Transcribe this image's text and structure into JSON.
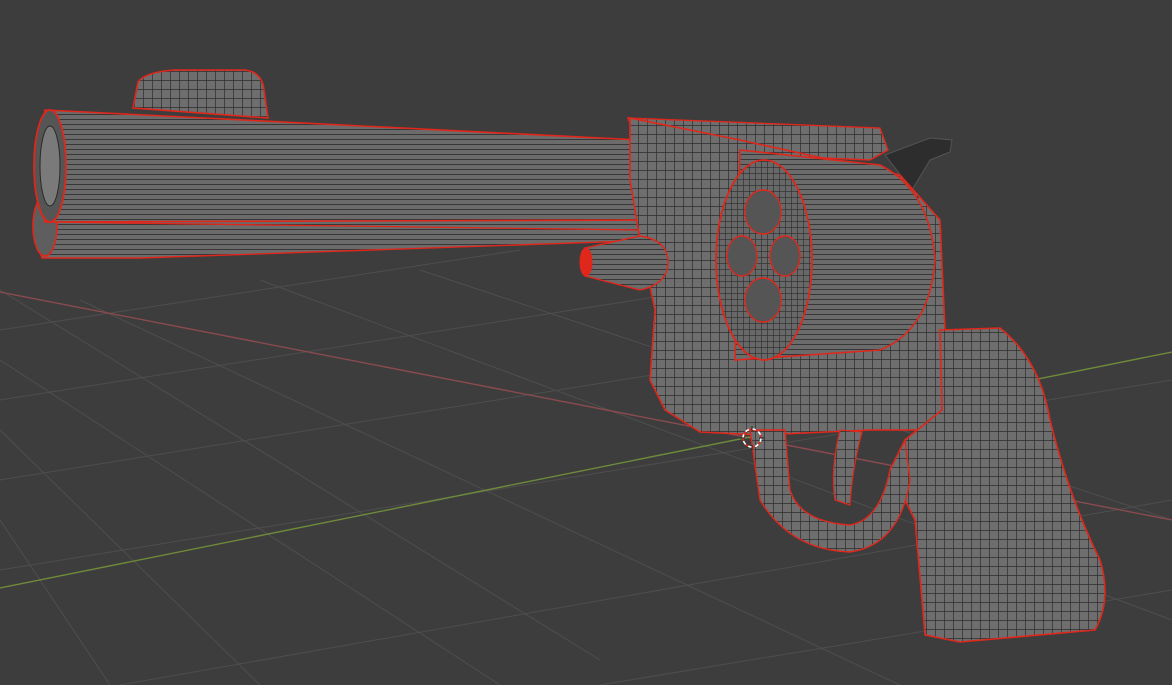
{
  "viewport": {
    "background": "#3d3d3d",
    "grid_color": "#4e4e4e",
    "x_axis_color": "#8a4a4f",
    "y_axis_color": "#6e8a3a"
  },
  "mesh": {
    "object": "revolver",
    "surface_fill": "#6b6b6b",
    "surface_shade": "#5a5a5a",
    "wire_color": "#2a2a2a",
    "seam_color": "#e0271b"
  },
  "origin": {
    "icon": "3d-cursor-icon",
    "ring_color": "#ffffff",
    "dash_color": "#e0271b"
  }
}
